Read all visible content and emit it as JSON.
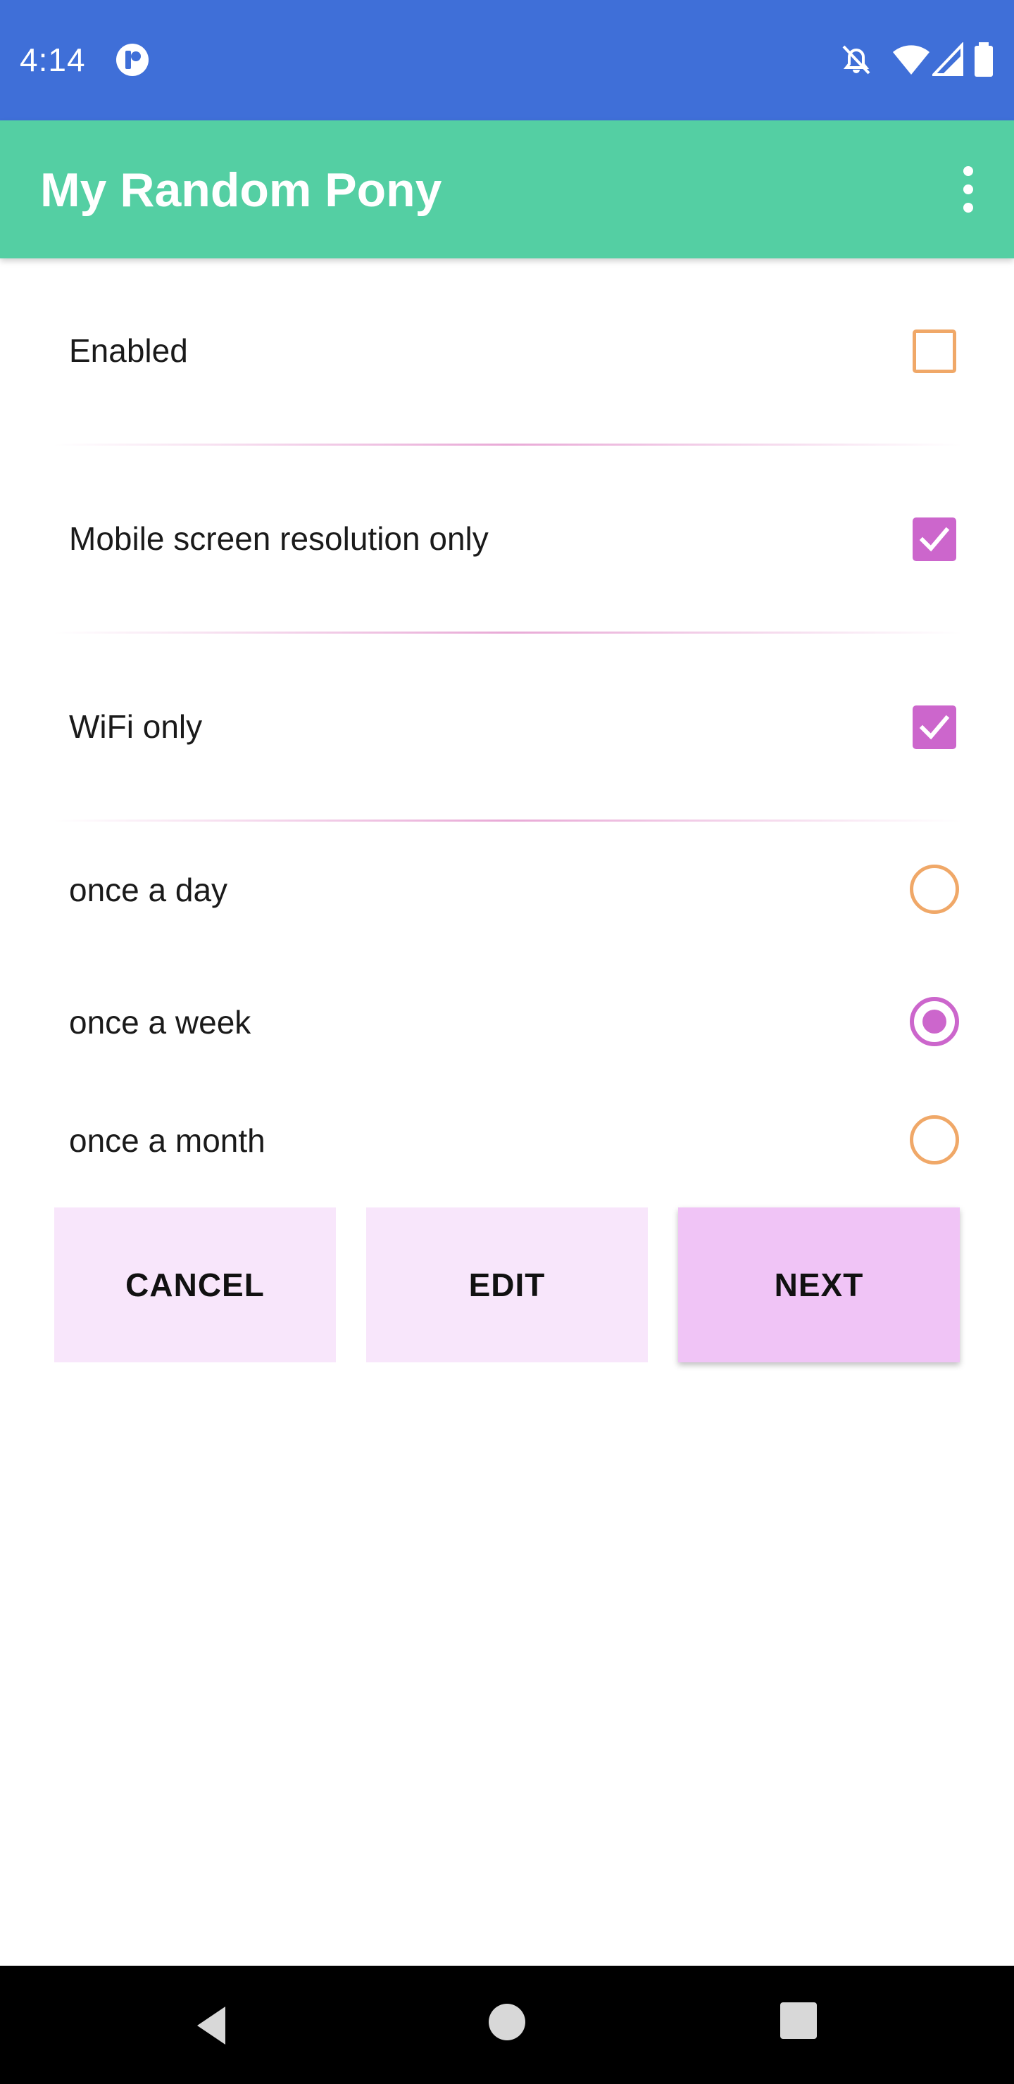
{
  "status_bar": {
    "time": "4:14",
    "icons": [
      "app-notification-icon",
      "notifications-off-icon",
      "wifi-icon",
      "signal-icon",
      "battery-icon"
    ]
  },
  "app_bar": {
    "title": "My Random Pony",
    "menu_icon": "more-vert-icon"
  },
  "preferences": [
    {
      "label": "Enabled",
      "checked": false
    },
    {
      "label": "Mobile screen resolution only",
      "checked": true
    },
    {
      "label": "WiFi only",
      "checked": true
    }
  ],
  "frequency": {
    "options": [
      "once a day",
      "once a week",
      "once a month"
    ],
    "selected": "once a week"
  },
  "buttons": {
    "cancel": "CANCEL",
    "edit": "EDIT",
    "next": "NEXT"
  },
  "nav_bar": {
    "icons": [
      "back-icon",
      "home-icon",
      "recents-icon"
    ]
  },
  "colors": {
    "status_bar": "#3f6fd8",
    "app_bar": "#54cfa3",
    "accent": "#cc66cc",
    "unchecked": "#f0a868",
    "button_light": "#f8e6fb",
    "button_strong": "#f0c4f6"
  }
}
